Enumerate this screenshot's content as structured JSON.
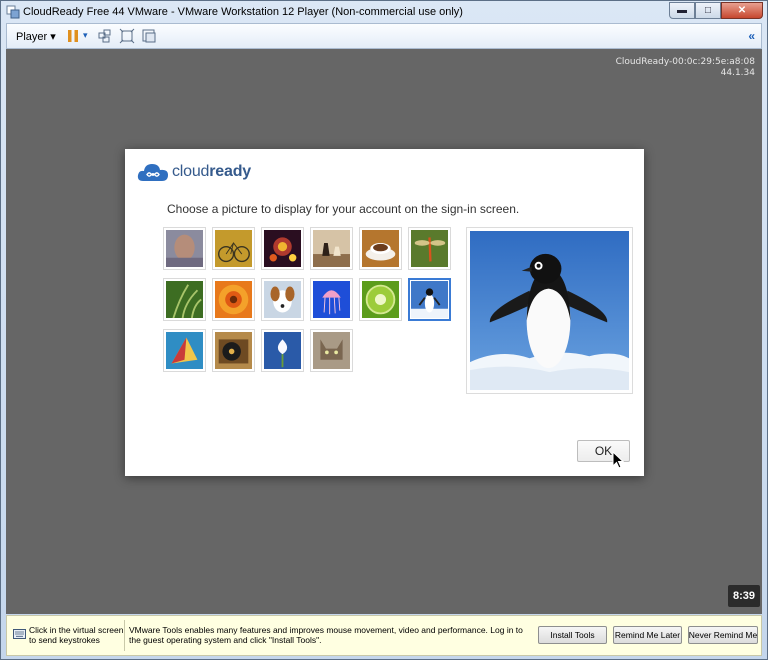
{
  "window": {
    "title": "CloudReady Free 44 VMware - VMware Workstation 12 Player (Non-commercial use only)",
    "caption_buttons": [
      "minimize",
      "maximize",
      "close"
    ]
  },
  "toolbar": {
    "player_label": "Player",
    "icons": [
      "pause-icon",
      "send-ctrl-alt-del-icon",
      "fit-guest-icon",
      "unity-icon"
    ]
  },
  "guest": {
    "vm_id_line1": "CloudReady-00:0c:29:5e:a8:08",
    "vm_id_line2": "44.1.34",
    "clock": "8:39"
  },
  "dialog": {
    "brand_prefix": "cloud",
    "brand_suffix": "ready",
    "prompt": "Choose a picture to display for your account on the sign-in screen.",
    "pictures": [
      "profile-photo",
      "bicycle",
      "fireworks",
      "chess",
      "coffee",
      "dragonfly",
      "grass",
      "flower",
      "dog",
      "jellyfish",
      "kiwi",
      "penguin",
      "origami",
      "turntable",
      "snowdrop",
      "cat"
    ],
    "selected": "penguin",
    "ok_label": "OK"
  },
  "infobar": {
    "hint": "Click in the virtual screen to send keystrokes",
    "message": "VMware Tools enables many features and improves mouse movement, video and performance. Log in to the guest operating system and click \"Install Tools\".",
    "install_label": "Install Tools",
    "remind_label": "Remind Me Later",
    "never_label": "Never Remind Me"
  },
  "colors": {
    "guest_background": "#666666",
    "selection": "#3a7bd5",
    "brand": "#355a8c"
  }
}
